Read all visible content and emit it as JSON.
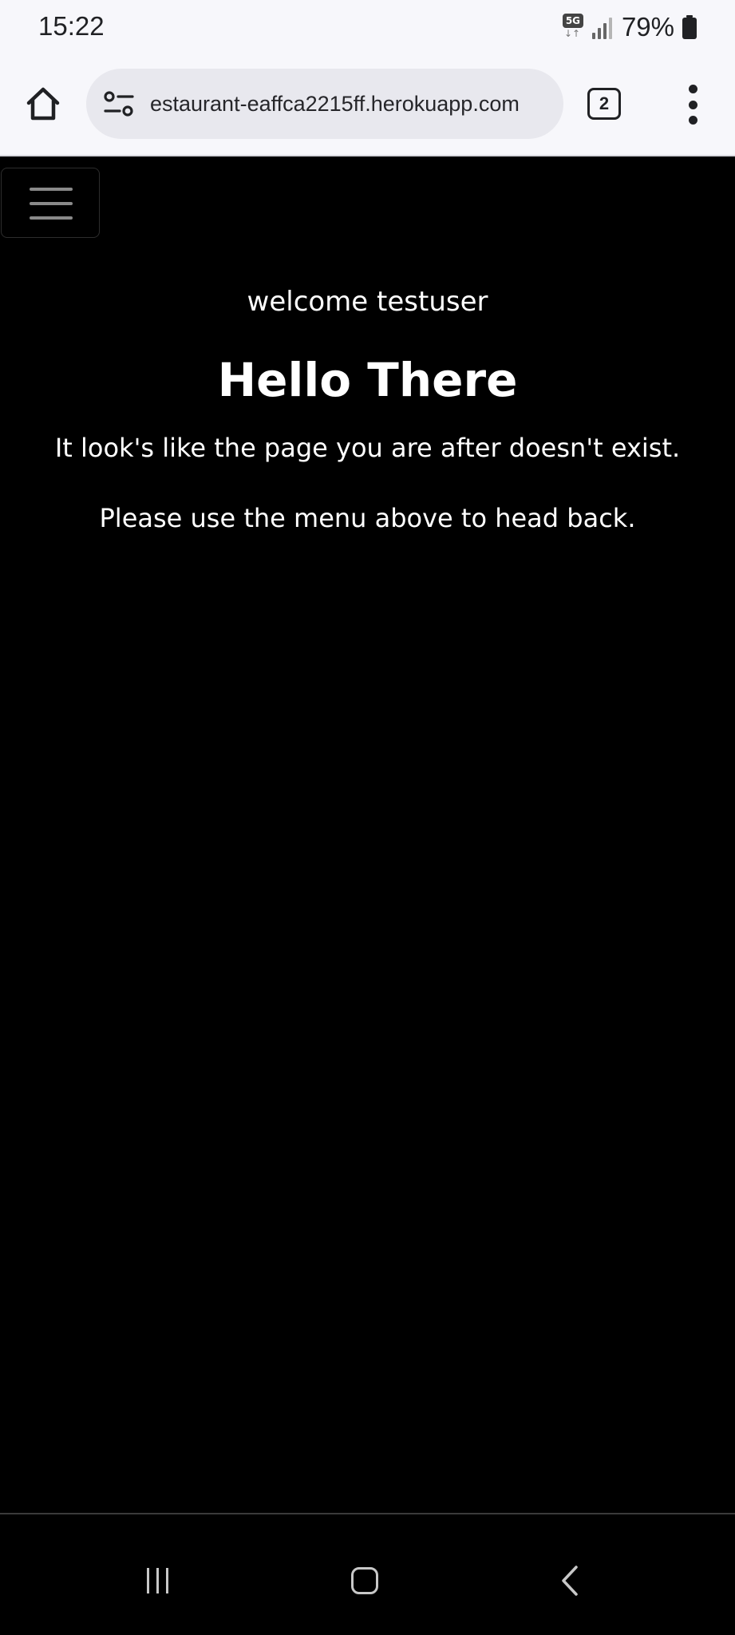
{
  "status_bar": {
    "time": "15:22",
    "network_badge": "5G",
    "battery_percent": "79%",
    "icons": [
      "5g-icon",
      "signal-icon",
      "battery-icon"
    ]
  },
  "browser": {
    "url": "estaurant-eaffca2215ff.herokuapp.com",
    "tab_count": "2",
    "icons": [
      "home-icon",
      "site-settings-icon",
      "tabs-icon",
      "more-options-icon"
    ]
  },
  "page": {
    "welcome_text": "welcome testuser",
    "heading": "Hello There",
    "message_line1": "It look's like the page you are after doesn't exist.",
    "message_line2": "Please use the menu above to head back.",
    "icons": [
      "hamburger-menu-icon"
    ]
  },
  "system_nav": {
    "icons": [
      "recent-apps-icon",
      "home-icon",
      "back-icon"
    ]
  },
  "colors": {
    "page_background": "#000000",
    "page_text": "#ffffff",
    "browser_chrome": "#f7f7fb",
    "omnibox": "#e8e8ee"
  }
}
